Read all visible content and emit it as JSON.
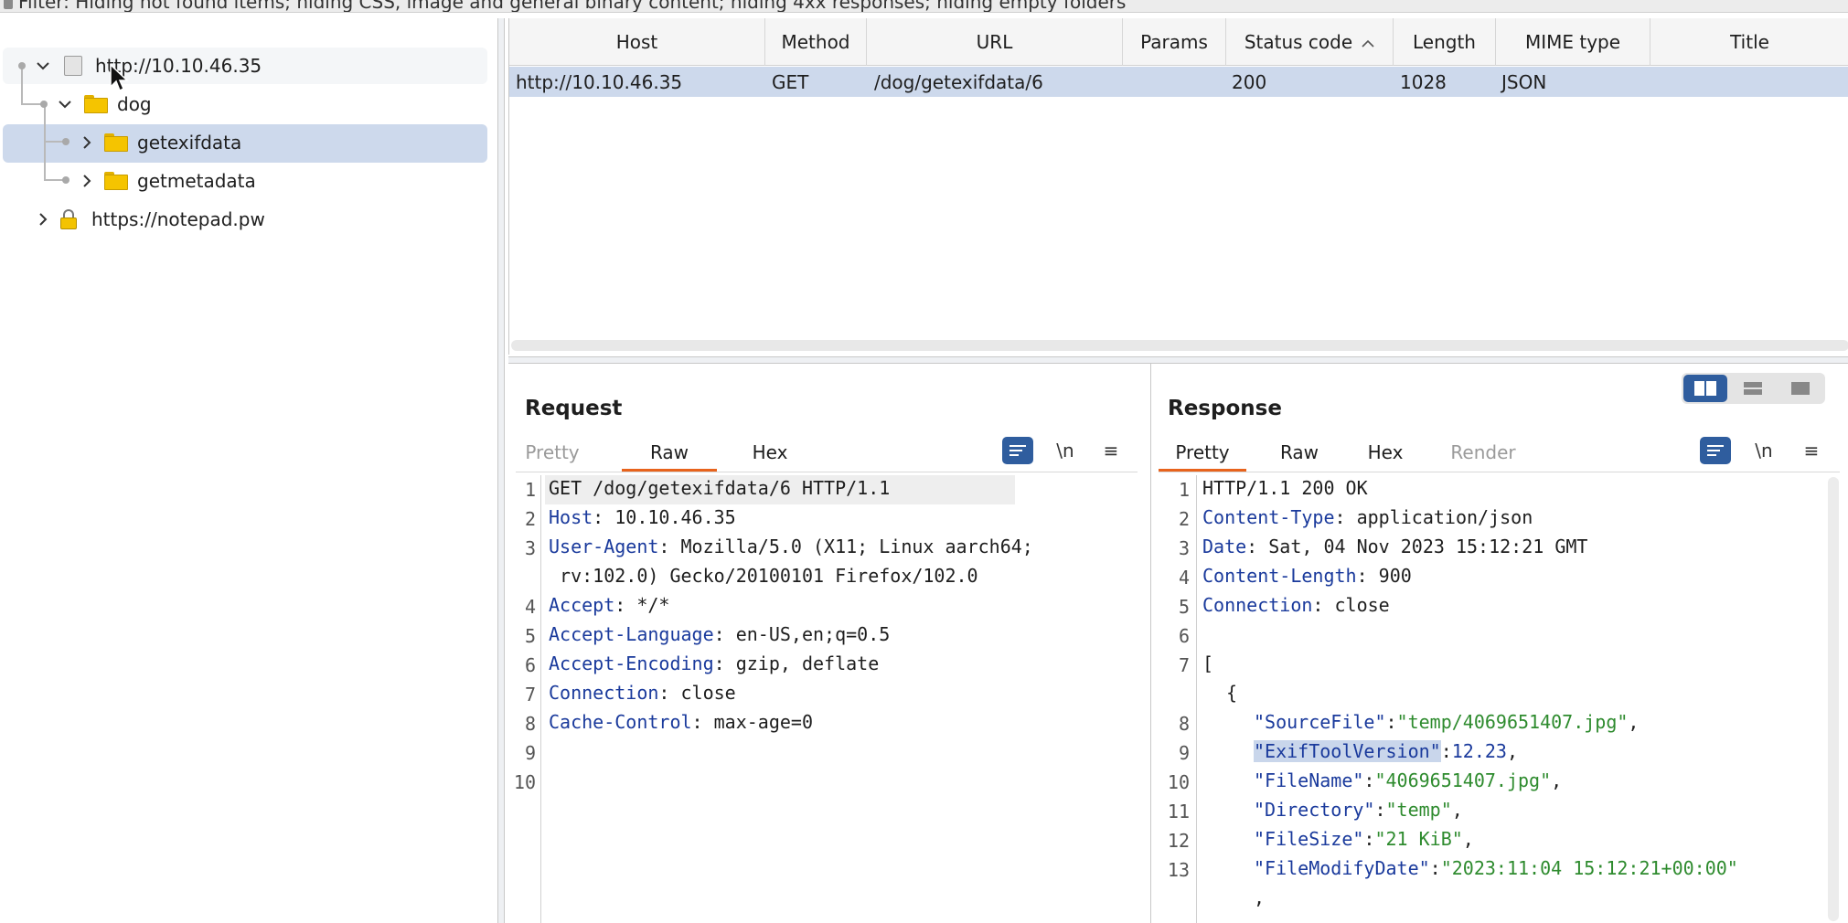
{
  "filter": {
    "text": "Filter: Hiding not found items;  hiding CSS, image and general binary content;  hiding 4xx responses;  hiding empty folders"
  },
  "tree": {
    "host": "http://10.10.46.35",
    "folder_dog": "dog",
    "item_getexifdata": "getexifdata",
    "item_getmetadata": "getmetadata",
    "host2": "https://notepad.pw"
  },
  "table": {
    "columns": [
      "Host",
      "Method",
      "URL",
      "Params",
      "Status code",
      "Length",
      "MIME type",
      "Title"
    ],
    "sort_indicator": "^",
    "rows": [
      {
        "host": "http://10.10.46.35",
        "method": "GET",
        "url": "/dog/getexifdata/6",
        "params": "",
        "status": "200",
        "length": "1028",
        "mime": "JSON",
        "title": ""
      }
    ]
  },
  "request": {
    "title": "Request",
    "tabs": [
      "Pretty",
      "Raw",
      "Hex"
    ],
    "active_tab": "Raw",
    "newline_label": "\\n",
    "menu_label": "≡",
    "line_numbers": [
      "1",
      "2",
      "3",
      "",
      "4",
      "5",
      "6",
      "7",
      "8",
      "9",
      "10"
    ],
    "lines": [
      {
        "key": "",
        "val": "GET /dog/getexifdata/6 HTTP/1.1"
      },
      {
        "key": "Host",
        "val": ": 10.10.46.35"
      },
      {
        "key": "User-Agent",
        "val": ": Mozilla/5.0 (X11; Linux aarch64;"
      },
      {
        "key": "",
        "val": " rv:102.0) Gecko/20100101 Firefox/102.0"
      },
      {
        "key": "Accept",
        "val": ": */*"
      },
      {
        "key": "Accept-Language",
        "val": ": en-US,en;q=0.5"
      },
      {
        "key": "Accept-Encoding",
        "val": ": gzip, deflate"
      },
      {
        "key": "Connection",
        "val": ": close"
      },
      {
        "key": "Cache-Control",
        "val": ": max-age=0"
      }
    ]
  },
  "response": {
    "title": "Response",
    "tabs": [
      "Pretty",
      "Raw",
      "Hex",
      "Render"
    ],
    "active_tab": "Pretty",
    "newline_label": "\\n",
    "menu_label": "≡",
    "line_numbers": [
      "1",
      "2",
      "3",
      "4",
      "5",
      "6",
      "7",
      "",
      "8",
      "9",
      "10",
      "11",
      "12",
      "13",
      ""
    ],
    "status_line": "HTTP/1.1 200 OK",
    "headers": [
      {
        "key": "Content-Type",
        "val": ": application/json"
      },
      {
        "key": "Date",
        "val": ": Sat, 04 Nov 2023 15:12:21 GMT"
      },
      {
        "key": "Content-Length",
        "val": ": 900"
      },
      {
        "key": "Connection",
        "val": ": close"
      }
    ],
    "open_bracket": "[",
    "open_brace": "{",
    "json": [
      {
        "key": "\"SourceFile\"",
        "sep": ":",
        "val": "\"temp/4069651407.jpg\"",
        "tail": ",",
        "num": false
      },
      {
        "key": "\"ExifToolVersion\"",
        "sep": ":",
        "val": "12.23",
        "tail": ",",
        "num": true
      },
      {
        "key": "\"FileName\"",
        "sep": ":",
        "val": "\"4069651407.jpg\"",
        "tail": ",",
        "num": false
      },
      {
        "key": "\"Directory\"",
        "sep": ":",
        "val": "\"temp\"",
        "tail": ",",
        "num": false
      },
      {
        "key": "\"FileSize\"",
        "sep": ":",
        "val": "\"21 KiB\"",
        "tail": ",",
        "num": false
      },
      {
        "key": "\"FileModifyDate\"",
        "sep": ":",
        "val": "\"2023:11:04 15:12:21+00:00\"",
        "tail": "",
        "num": false
      }
    ],
    "trailing_comma": ","
  },
  "colors": {
    "accent": "#e8631c",
    "selection": "#cdd9ec",
    "key": "#1a3a9c",
    "string": "#2e8b2e",
    "button": "#2f5d9e"
  }
}
